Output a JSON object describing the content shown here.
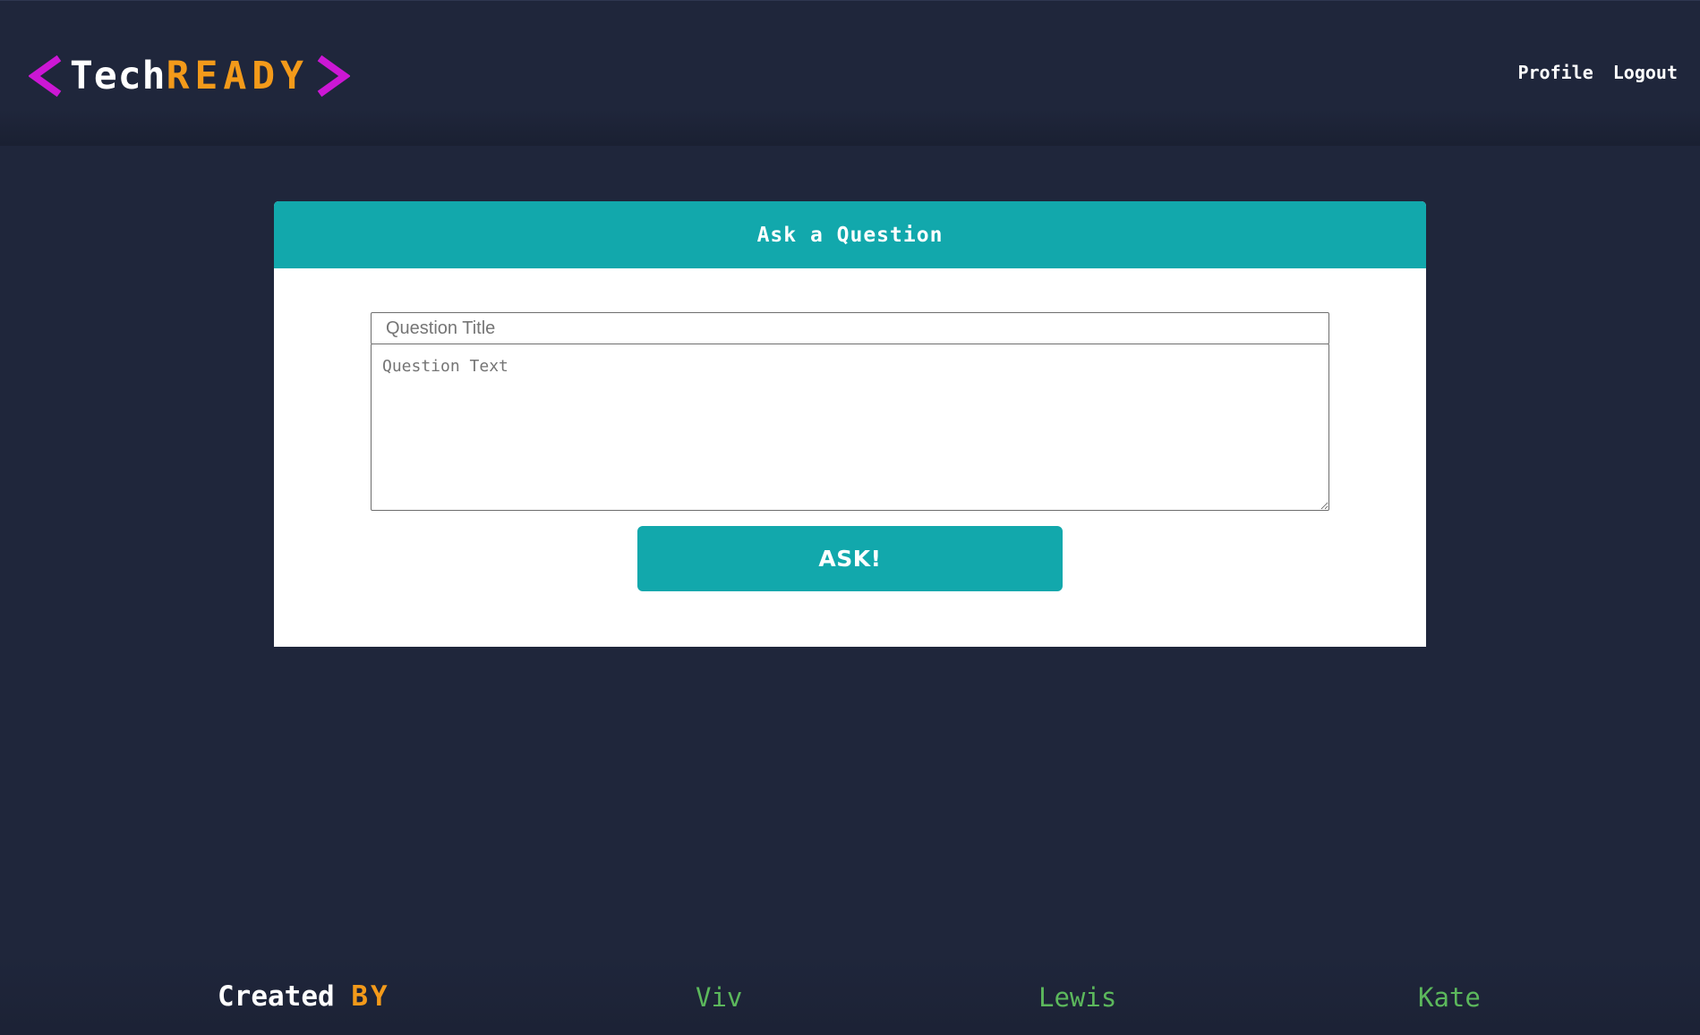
{
  "header": {
    "logo": {
      "left_bracket": "<",
      "word_part1": "Tech",
      "word_part2": "READY",
      "right_bracket": ">",
      "bracket_color": "#cc17d4",
      "accent_color": "#f39a1a"
    },
    "nav": [
      {
        "label": "Profile"
      },
      {
        "label": "Logout"
      }
    ]
  },
  "main": {
    "card_title": "Ask a Question",
    "title_input": {
      "value": "",
      "placeholder": "Question Title"
    },
    "text_input": {
      "value": "",
      "placeholder": "Question Text"
    },
    "ask_button": "ASK!",
    "accent_color": "#12a8ac"
  },
  "footer": {
    "created_label": "Created",
    "by_label": "BY",
    "members": [
      {
        "name": "Viv"
      },
      {
        "name": "Lewis"
      },
      {
        "name": "Kate"
      }
    ],
    "member_color": "#5cb85c"
  }
}
